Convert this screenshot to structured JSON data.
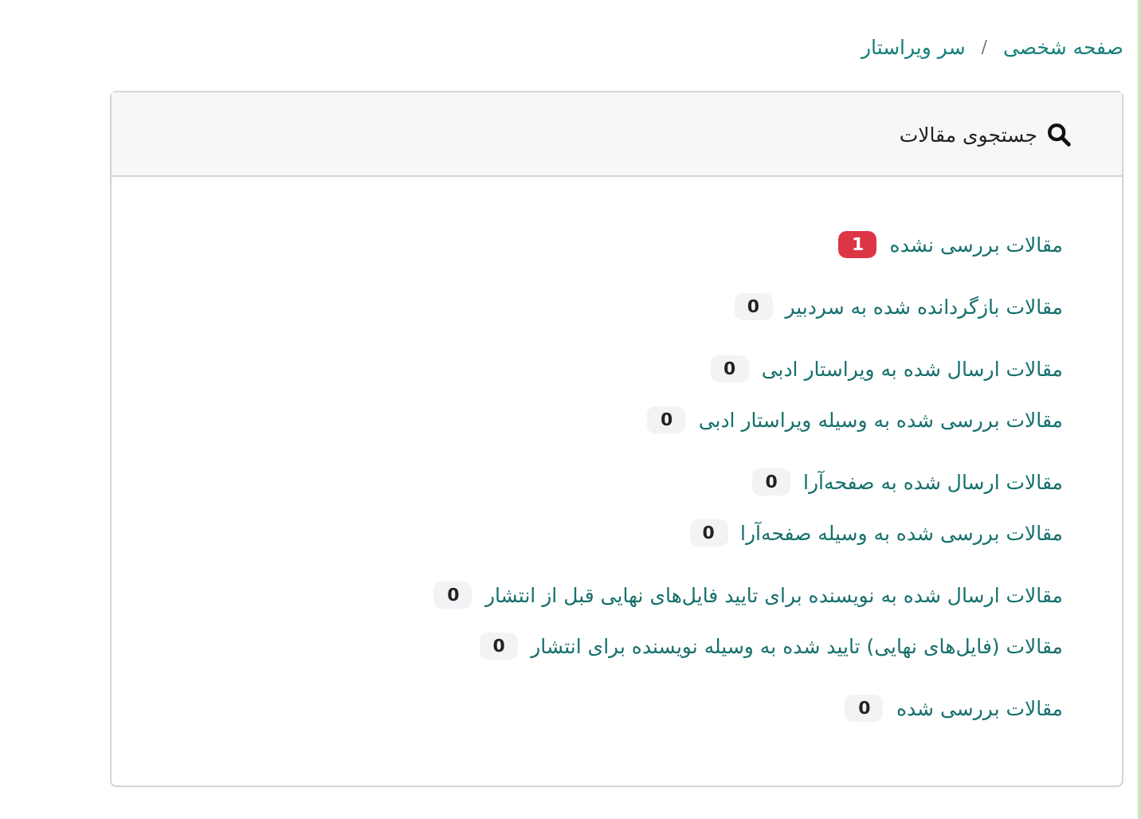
{
  "breadcrumb": [
    "صفحه شخصی",
    "سر ویراستار"
  ],
  "breadcrumb_separator": "/",
  "card": {
    "title": "جستجوی مقالات"
  },
  "groups": [
    {
      "items": [
        {
          "label": "مقالات بررسی نشده",
          "count": "1",
          "kind": "danger"
        }
      ]
    },
    {
      "items": [
        {
          "label": "مقالات بازگردانده شده به سردبیر",
          "count": "0",
          "kind": "light"
        }
      ]
    },
    {
      "items": [
        {
          "label": "مقالات ارسال شده به ویراستار ادبی",
          "count": "0",
          "kind": "light"
        },
        {
          "label": "مقالات بررسی شده به وسیله ویراستار ادبی",
          "count": "0",
          "kind": "light"
        }
      ]
    },
    {
      "items": [
        {
          "label": "مقالات ارسال شده به صفحه‌آرا",
          "count": "0",
          "kind": "light"
        },
        {
          "label": "مقالات بررسی شده به وسیله صفحه‌آرا",
          "count": "0",
          "kind": "light"
        }
      ]
    },
    {
      "items": [
        {
          "label": "مقالات ارسال شده به نویسنده برای تایید فایل‌های نهایی قبل از انتشار",
          "count": "0",
          "kind": "light"
        },
        {
          "label": "مقالات (فایل‌های نهایی) تایید شده به وسیله نویسنده برای انتشار",
          "count": "0",
          "kind": "light"
        }
      ]
    },
    {
      "items": [
        {
          "label": "مقالات بررسی شده",
          "count": "0",
          "kind": "light"
        }
      ]
    }
  ]
}
